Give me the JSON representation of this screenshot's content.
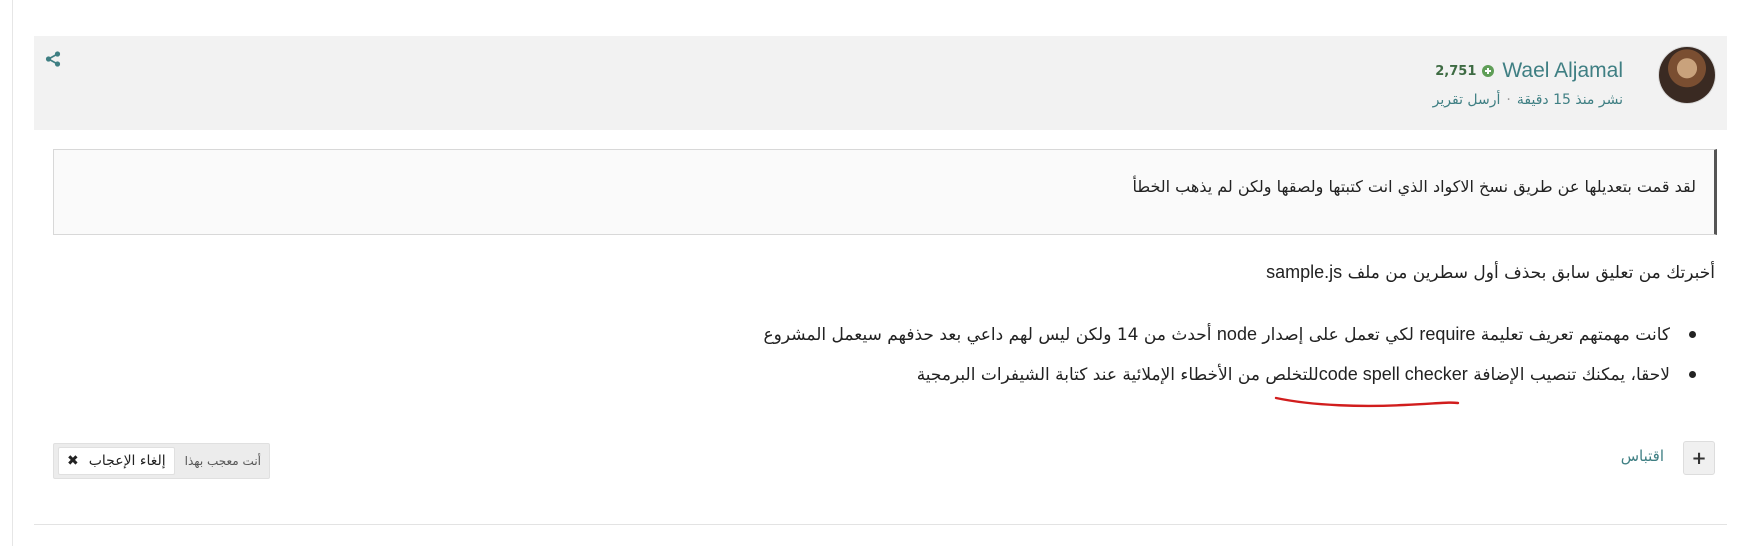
{
  "post": {
    "author_name": "Wael Aljamal",
    "reputation": "2,751",
    "posted_time": "نشر منذ 15 دقيقة",
    "report_link": "أرسل تقرير",
    "separator": "·",
    "quote_text": "لقد قمت بتعديلها عن طريق نسخ الاكواد الذي انت كتبتها ولصقها ولكن لم يذهب الخطأ",
    "body_intro": "أخبرتك من تعليق سابق بحذف أول سطرين من ملف",
    "body_intro_file": "sample.js",
    "bullets": [
      {
        "part1": "كانت مهمتهم تعريف تعليمة",
        "code1": "require",
        "part2": "لكي تعمل على إصدار",
        "code2": "node",
        "part3": "أحدث من 14 ولكن ليس لهم داعي بعد حذفهم سيعمل المشروع"
      },
      {
        "part1": "لاحقا، يمكنك تنصيب الإضافة",
        "code1": "code spell checker",
        "part2": "للتخلص من الأخطاء الإملائية عند كتابة الشيفرات البرمجية"
      }
    ]
  },
  "actions": {
    "plus_label": "+",
    "quote_label": "اقتباس",
    "liked_label": "أنت معجب بهذا",
    "unlike_label": "إلغاء الإعجاب",
    "unlike_icon": "✖"
  },
  "colors": {
    "accent": "#3f7f83",
    "reputation": "#3e6b43",
    "underline": "#d11d1d"
  },
  "icons": {
    "share": "share-icon",
    "reputation": "plus-circle-icon",
    "remove": "x-icon"
  }
}
